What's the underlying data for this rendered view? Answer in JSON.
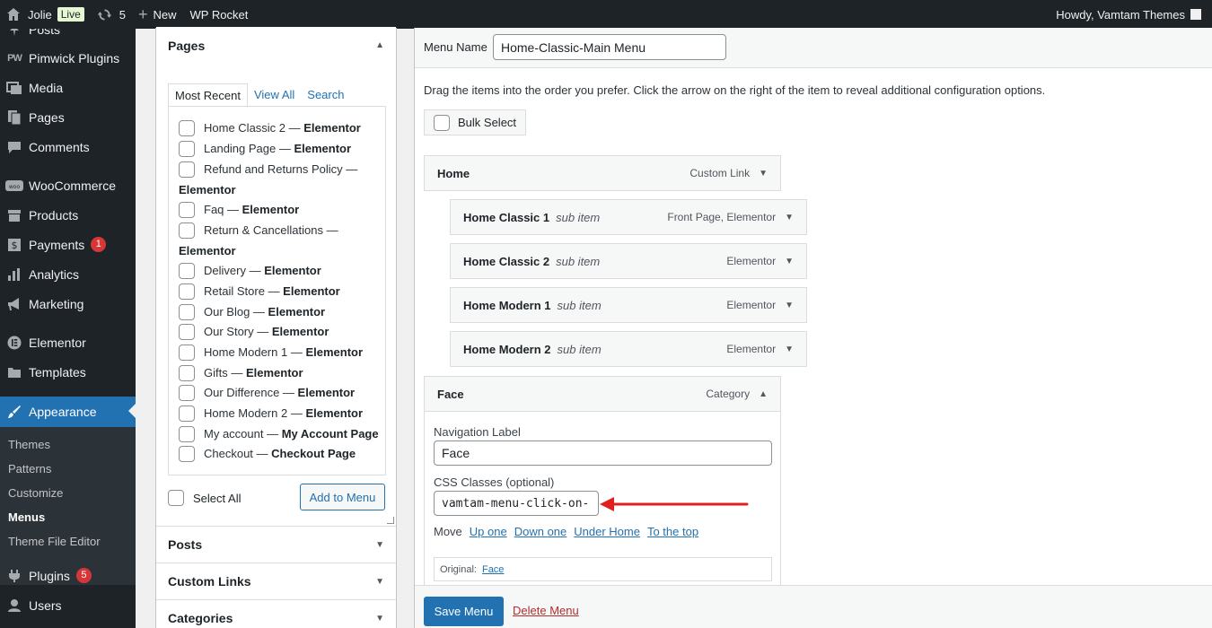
{
  "adminbar": {
    "site_name": "Jolie",
    "live_label": "Live",
    "updates_count": "5",
    "new_label": "New",
    "wp_rocket_label": "WP Rocket",
    "howdy": "Howdy, Vamtam Themes"
  },
  "sidebar": {
    "items": [
      {
        "label": "Posts",
        "icon": "pushpin-icon"
      },
      {
        "label": "Pimwick Plugins",
        "icon": "pw-logo-icon"
      },
      {
        "label": "Media",
        "icon": "media-icon"
      },
      {
        "label": "Pages",
        "icon": "pages-icon"
      },
      {
        "label": "Comments",
        "icon": "comment-icon"
      },
      {
        "label": "WooCommerce",
        "icon": "woo-icon"
      },
      {
        "label": "Products",
        "icon": "archive-icon"
      },
      {
        "label": "Payments",
        "icon": "dollar-icon",
        "count": "1"
      },
      {
        "label": "Analytics",
        "icon": "bar-chart-icon"
      },
      {
        "label": "Marketing",
        "icon": "megaphone-icon"
      },
      {
        "label": "Elementor",
        "icon": "elementor-icon"
      },
      {
        "label": "Templates",
        "icon": "folder-icon"
      },
      {
        "label": "Appearance",
        "icon": "brush-icon"
      },
      {
        "label": "Plugins",
        "icon": "plug-icon",
        "count": "5"
      },
      {
        "label": "Users",
        "icon": "user-icon"
      }
    ],
    "appearance_sub": [
      "Themes",
      "Patterns",
      "Customize",
      "Menus",
      "Theme File Editor"
    ]
  },
  "pages_box": {
    "title": "Pages",
    "tabs": [
      "Most Recent",
      "View All",
      "Search"
    ],
    "items": [
      {
        "name": "Home Classic 2",
        "tag": "Elementor"
      },
      {
        "name": "Landing Page",
        "tag": "Elementor"
      },
      {
        "name": "Refund and Returns Policy",
        "tag": "Elementor"
      },
      {
        "name": "Faq",
        "tag": "Elementor"
      },
      {
        "name": "Return & Cancellations",
        "tag": "Elementor"
      },
      {
        "name": "Delivery",
        "tag": "Elementor"
      },
      {
        "name": "Retail Store",
        "tag": "Elementor"
      },
      {
        "name": "Our Blog",
        "tag": "Elementor"
      },
      {
        "name": "Our Story",
        "tag": "Elementor"
      },
      {
        "name": "Home Modern 1",
        "tag": "Elementor"
      },
      {
        "name": "Gifts",
        "tag": "Elementor"
      },
      {
        "name": "Our Difference",
        "tag": "Elementor"
      },
      {
        "name": "Home Modern 2",
        "tag": "Elementor"
      },
      {
        "name": "My account",
        "tag": "My Account Page"
      },
      {
        "name": "Checkout",
        "tag": "Checkout Page"
      }
    ],
    "separator": " — ",
    "select_all": "Select All",
    "add_button": "Add to Menu"
  },
  "other_boxes": [
    "Posts",
    "Custom Links",
    "Categories"
  ],
  "editor": {
    "menu_name_label": "Menu Name",
    "menu_name_value": "Home-Classic-Main Menu",
    "instructions": "Drag the items into the order you prefer. Click the arrow on the right of the item to reveal additional configuration options.",
    "bulk_select": "Bulk Select",
    "items": [
      {
        "title": "Home",
        "sub": "",
        "type": "Custom Link"
      },
      {
        "title": "Home Classic 1",
        "sub": "sub item",
        "type": "Front Page, Elementor"
      },
      {
        "title": "Home Classic 2",
        "sub": "sub item",
        "type": "Elementor"
      },
      {
        "title": "Home Modern 1",
        "sub": "sub item",
        "type": "Elementor"
      },
      {
        "title": "Home Modern 2",
        "sub": "sub item",
        "type": "Elementor"
      },
      {
        "title": "Face",
        "sub": "",
        "type": "Category"
      }
    ],
    "settings": {
      "nav_label": "Navigation Label",
      "nav_value": "Face",
      "css_label": "CSS Classes (optional)",
      "css_value": "vamtam-menu-click-on-",
      "move_label": "Move",
      "move_links": [
        "Up one",
        "Down one",
        "Under Home",
        "To the top"
      ],
      "original_label": "Original:",
      "original_link": "Face"
    },
    "save_button": "Save Menu",
    "delete_link": "Delete Menu"
  },
  "colors": {
    "wp_dark": "#1d2327",
    "wp_blue": "#2271b1",
    "badge_red": "#d63638",
    "annotation_red": "#e0201f"
  }
}
